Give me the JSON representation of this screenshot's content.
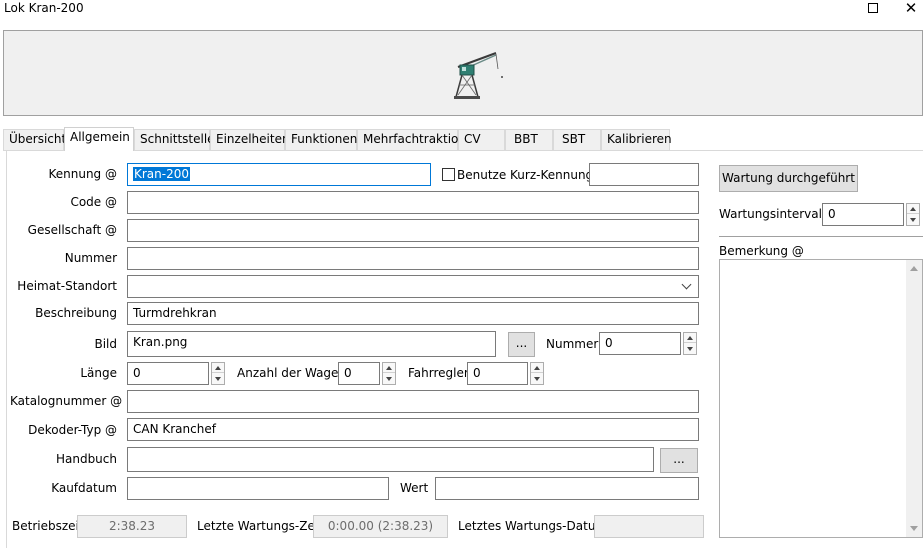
{
  "window": {
    "title": "Lok Kran-200",
    "maximize_glyph": "maximize-icon",
    "close_glyph": "✕"
  },
  "banner": {
    "image_icon": "crane-icon"
  },
  "tabs": [
    {
      "label": "Übersicht",
      "active": false
    },
    {
      "label": "Allgemein",
      "active": true
    },
    {
      "label": "Schnittstelle",
      "active": false
    },
    {
      "label": "Einzelheiten",
      "active": false
    },
    {
      "label": "Funktionen",
      "active": false
    },
    {
      "label": "Mehrfachtraktion",
      "active": false
    },
    {
      "label": "CV",
      "active": false
    },
    {
      "label": "BBT",
      "active": false
    },
    {
      "label": "SBT",
      "active": false
    },
    {
      "label": "Kalibrieren",
      "active": false
    }
  ],
  "form": {
    "kennung": {
      "label": "Kennung @",
      "value": "Kran-200"
    },
    "kurz_kennung": {
      "label": "Benutze Kurz-Kennung",
      "checked": false,
      "value": ""
    },
    "code": {
      "label": "Code @",
      "value": ""
    },
    "gesellschaft": {
      "label": "Gesellschaft @",
      "value": ""
    },
    "nummer": {
      "label": "Nummer",
      "value": ""
    },
    "heimat_standort": {
      "label": "Heimat-Standort",
      "value": ""
    },
    "beschreibung": {
      "label": "Beschreibung",
      "value": "Turmdrehkran"
    },
    "bild": {
      "label": "Bild",
      "value": "Kran.png",
      "browse_label": "..."
    },
    "bild_nummer": {
      "label": "Nummer",
      "value": "0"
    },
    "laenge": {
      "label": "Länge",
      "value": "0"
    },
    "anzahl_wagen": {
      "label": "Anzahl der Wagen",
      "value": "0"
    },
    "fahrregler": {
      "label": "Fahrregler",
      "value": "0"
    },
    "katalognummer": {
      "label": "Katalognummer @",
      "value": ""
    },
    "dekoder_typ": {
      "label": "Dekoder-Typ @",
      "value": "CAN Kranchef"
    },
    "handbuch": {
      "label": "Handbuch",
      "value": "",
      "browse_label": "..."
    },
    "kaufdatum": {
      "label": "Kaufdatum",
      "value": ""
    },
    "wert": {
      "label": "Wert",
      "value": ""
    },
    "betriebszeit": {
      "label": "Betriebszeit",
      "value": "2:38.23"
    },
    "letzte_wartungs_zeit": {
      "label": "Letzte Wartungs-Zeit",
      "value": "0:00.00 (2:38.23)"
    },
    "letztes_wartungs_datum": {
      "label": "Letztes Wartungs-Datum",
      "value": ""
    }
  },
  "right": {
    "wartung_button": "Wartung durchgeführt",
    "wartungsintervall": {
      "label": "Wartungsintervall",
      "value": "0"
    },
    "bemerkung": {
      "label": "Bemerkung @",
      "value": ""
    }
  }
}
